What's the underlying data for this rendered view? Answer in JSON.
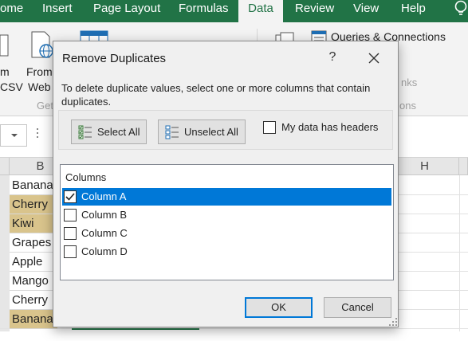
{
  "ribbon_tabs": [
    {
      "label": "ome"
    },
    {
      "label": "Insert"
    },
    {
      "label": "Page Layout"
    },
    {
      "label": "Formulas"
    },
    {
      "label": "Data"
    },
    {
      "label": "Review"
    },
    {
      "label": "View"
    },
    {
      "label": "Help"
    }
  ],
  "active_tab": "Data",
  "ribbon": {
    "csv_top": "m",
    "csv_bottom": "CSV",
    "web_top": "From",
    "web_bottom": "Web",
    "group_get": "Get",
    "queries_connections": "Queries & Connections",
    "links_partial": "nks",
    "ons_partial": "ons"
  },
  "sheet": {
    "columns": {
      "b": "B",
      "h": "H"
    },
    "cells": [
      {
        "value": "Banana",
        "highlight": false
      },
      {
        "value": "Cherry",
        "highlight": true
      },
      {
        "value": "Kiwi",
        "highlight": true
      },
      {
        "value": "Grapes",
        "highlight": false
      },
      {
        "value": "Apple",
        "highlight": false
      },
      {
        "value": "Mango",
        "highlight": false
      },
      {
        "value": "Cherry",
        "highlight": false
      },
      {
        "value": "Banana",
        "highlight": true
      }
    ],
    "highlight_color": "#d9c48c"
  },
  "dialog": {
    "title": "Remove Duplicates",
    "help": "?",
    "description": "To delete duplicate values, select one or more columns that contain duplicates.",
    "select_all": "Select All",
    "unselect_all": "Unselect All",
    "my_data_has_headers": "My data has headers",
    "headers_checked": false,
    "columns_header": "Columns",
    "columns": [
      {
        "label": "Column A",
        "checked": true,
        "selected": true
      },
      {
        "label": "Column B",
        "checked": false,
        "selected": false
      },
      {
        "label": "Column C",
        "checked": false,
        "selected": false
      },
      {
        "label": "Column D",
        "checked": false,
        "selected": false
      }
    ],
    "ok": "OK",
    "cancel": "Cancel"
  },
  "colors": {
    "excel_green": "#217346",
    "selection_blue": "#0078d7"
  }
}
